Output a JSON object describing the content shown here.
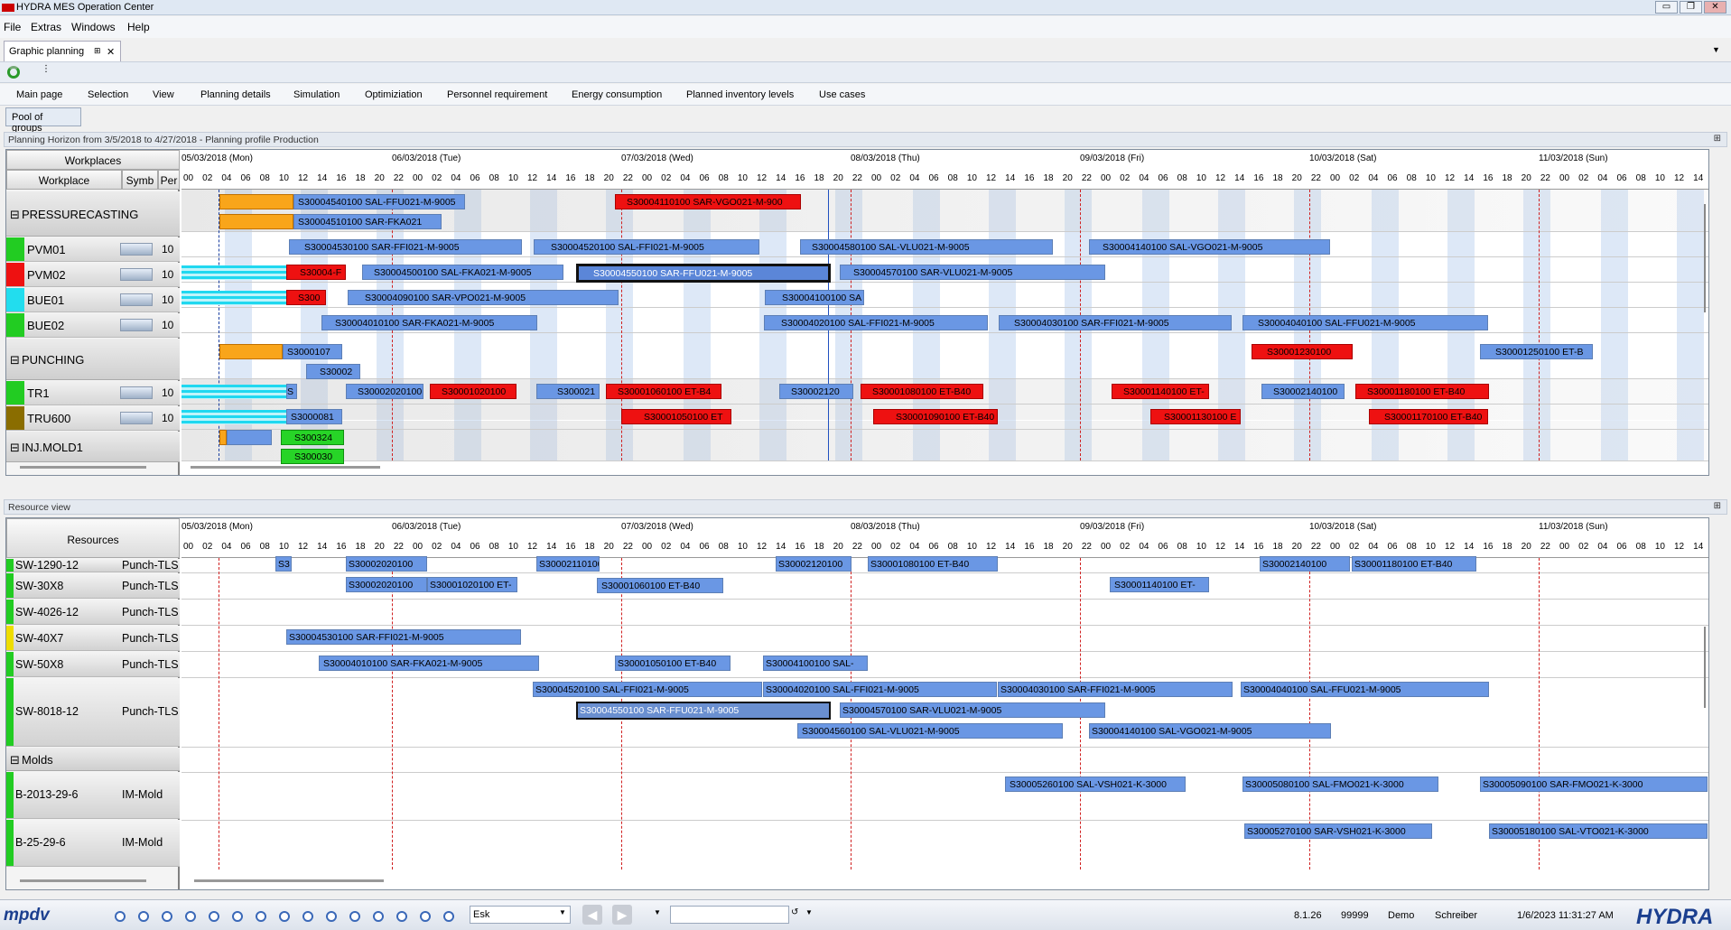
{
  "window": {
    "title": "HYDRA MES Operation Center",
    "buttons": [
      "▭",
      "❐",
      "✕"
    ]
  },
  "menu": [
    "File",
    "Extras",
    "Windows",
    "Help"
  ],
  "doc_tab": {
    "label": "Graphic planning",
    "pin": "⊞",
    "close": "✕"
  },
  "ribbon": [
    "Main page",
    "Selection",
    "View",
    "Planning details",
    "Simulation",
    "Optimiziation",
    "Personnel requirement",
    "Energy consumption",
    "Planned inventory levels",
    "Use cases"
  ],
  "pool_button": "Pool of groups",
  "planning": {
    "header": "Planning Horizon from 3/5/2018 to 4/27/2018  - Planning profile Production",
    "col_group": "Workplaces",
    "col_workplace": "Workplace",
    "col_symb": "Symb",
    "col_per": "Per",
    "dates": [
      "05/03/2018 (Mon)",
      "06/03/2018 (Tue)",
      "07/03/2018 (Wed)",
      "08/03/2018 (Thu)",
      "09/03/2018 (Fri)",
      "10/03/2018 (Sat)",
      "11/03/2018 (Sun)"
    ],
    "hours": [
      "02",
      "04",
      "06",
      "08",
      "10",
      "12",
      "14",
      "16",
      "18",
      "20",
      "22",
      "00"
    ],
    "groups": [
      {
        "name": "PRESSURECASTING"
      },
      {
        "name": "PUNCHING"
      },
      {
        "name": "INJ.MOLD1"
      }
    ],
    "workplaces": [
      {
        "name": "PVM01",
        "color": "#22cc22",
        "per": "10"
      },
      {
        "name": "PVM02",
        "color": "#ee1111",
        "per": "10"
      },
      {
        "name": "BUE01",
        "color": "#22ddee",
        "per": "10"
      },
      {
        "name": "BUE02",
        "color": "#22cc22",
        "per": "10"
      },
      {
        "name": "TR1",
        "color": "#22cc22",
        "per": "10"
      },
      {
        "name": "TRU600",
        "color": "#8a6d00",
        "per": "10"
      }
    ],
    "orders": {
      "pc1": "S30004540100 SAL-FFU021-M-9005",
      "pc2": "S30004510100 SAR-FKA021",
      "pc3": "S30004110100  SAR-VGO021-M-900",
      "v1a": "S30004530100 SAR-FFI021-M-9005",
      "v1b": "S30004520100 SAL-FFI021-M-9005",
      "v1c": "S30004580100 SAL-VLU021-M-9005",
      "v1d": "S30004140100 SAL-VGO021-M-9005",
      "v2a": "S30004-F",
      "v2b": "S30004500100 SAL-FKA021-M-9005",
      "v2c": "S30004550100 SAR-FFU021-M-9005",
      "v2d": "S30004570100 SAR-VLU021-M-9005",
      "b1a": "S300",
      "b1b": "S30004090100 SAR-VPO021-M-9005",
      "b1c": "S30004100100 SA",
      "b2a": "S30004010100 SAR-FKA021-M-9005",
      "b2b": "S30004020100 SAL-FFI021-M-9005",
      "b2c": "S30004030100 SAR-FFI021-M-9005",
      "b2d": "S30004040100 SAL-FFU021-M-9005",
      "pu1": "S3000107",
      "pu2": "S30002",
      "pu3": "S30001230100",
      "pu4": "S30001250100  ET-B",
      "t1a": "S",
      "t1b": "S30002020100",
      "t1c": "S30001020100",
      "t1d": "S300021",
      "t1e": "S30001060100  ET-B4",
      "t1f": "S30002120",
      "t1g": "S30001080100 ET-B40",
      "t1h": "S30001140100 ET-",
      "t1i": "S30002140100",
      "t1j": "S30001180100 ET-B40",
      "t6a": "S3000081",
      "t6b": "S30001050100  ET",
      "t6c": "S30001090100 ET-B40",
      "t6d": "S30001130100 E",
      "t6e": "S30001170100 ET-B40",
      "im1": "S300324",
      "im2": "S300030"
    }
  },
  "resource": {
    "header": "Resource view",
    "col_resources": "Resources",
    "group_molds": "Molds",
    "rows": [
      {
        "name": "SW-1290-12",
        "type": "Punch-TLS",
        "color": "#22cc22"
      },
      {
        "name": "SW-30X8",
        "type": "Punch-TLS",
        "color": "#22cc22"
      },
      {
        "name": "SW-4026-12",
        "type": "Punch-TLS",
        "color": "#22cc22"
      },
      {
        "name": "SW-40X7",
        "type": "Punch-TLS",
        "color": "#eedd00"
      },
      {
        "name": "SW-50X8",
        "type": "Punch-TLS",
        "color": "#22cc22"
      },
      {
        "name": "SW-8018-12",
        "type": "Punch-TLS",
        "color": "#22cc22"
      },
      {
        "name": "B-2013-29-6",
        "type": "IM-Mold",
        "color": "#22cc22"
      },
      {
        "name": "B-25-29-6",
        "type": "IM-Mold",
        "color": "#22cc22"
      }
    ],
    "orders": {
      "r1a": "S3",
      "r1b": "S30002020100",
      "r1c": "S30002110100",
      "r1d": "S30002120100",
      "r1e": "S30001080100 ET-B40",
      "r1f": "S30002140100",
      "r1g": "S30001180100 ET-B40",
      "r2a": "S30002020100",
      "r2b": "S30001020100 ET-",
      "r2c": "S30001060100 ET-B40",
      "r2d": "S30001140100 ET-",
      "r4a": "S30004530100 SAR-FFI021-M-9005",
      "r5a": "S30004010100 SAR-FKA021-M-9005",
      "r5b": "S30001050100 ET-B40",
      "r5c": "S30004100100 SAL-",
      "r6a": "S30004520100 SAL-FFI021-M-9005",
      "r6b": "S30004020100 SAL-FFI021-M-9005",
      "r6c": "S30004030100 SAR-FFI021-M-9005",
      "r6d": "S30004040100 SAL-FFU021-M-9005",
      "r6e": "S30004550100 SAR-FFU021-M-9005",
      "r6f": "S30004570100 SAR-VLU021-M-9005",
      "r6g": "S30004560100 SAL-VLU021-M-9005",
      "r6h": "S30004140100 SAL-VGO021-M-9005",
      "m1a": "S30005260100 SAL-VSH021-K-3000",
      "m1b": "S30005080100 SAL-FMO021-K-3000",
      "m1c": "S30005090100 SAR-FMO021-K-3000",
      "m2a": "S30005270100 SAR-VSH021-K-3000",
      "m2b": "S30005180100 SAL-VTO021-K-3000"
    }
  },
  "statusbar": {
    "mpdv": "mpdv",
    "search_value": "Esk",
    "search2_value": "",
    "version": "8.1.26",
    "code": "99999",
    "mode": "Demo",
    "user": "Schreiber",
    "datetime": "1/6/2023 11:31:27 AM",
    "brand": "HYDRA"
  },
  "colors": {
    "accent": "#1b3f8f",
    "bar_blue": "#6a97e4",
    "bar_red": "#ee1111",
    "bar_orange": "#f9a51a",
    "bar_green": "#27d427"
  }
}
